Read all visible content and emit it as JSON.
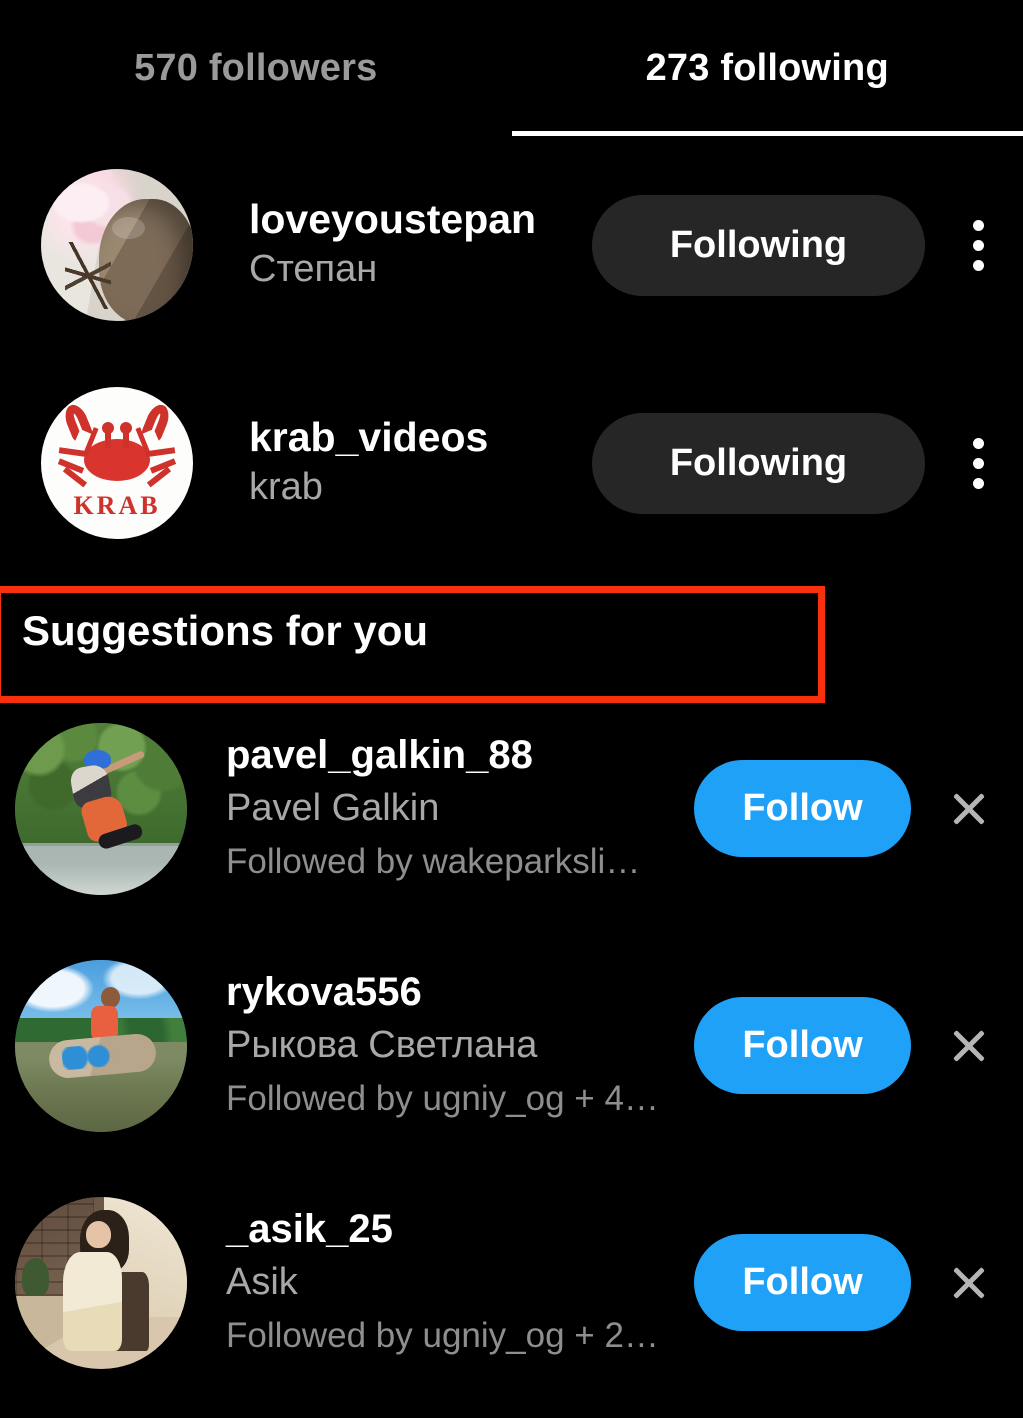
{
  "tabs": [
    {
      "label": "570 followers",
      "name": "tab-followers",
      "active": false
    },
    {
      "label": "273 following",
      "name": "tab-following",
      "active": true
    }
  ],
  "following_list": [
    {
      "username": "loveyoustepan",
      "fullname": "Степан",
      "button_label": "Following",
      "avatar": "cat-with-magnolia-flower",
      "menu_icon": "kebab-menu-icon"
    },
    {
      "username": "krab_videos",
      "fullname": "krab",
      "button_label": "Following",
      "avatar": "red-crab-logo",
      "avatar_text": "KRAB",
      "menu_icon": "kebab-menu-icon"
    }
  ],
  "suggestions_section": {
    "title": "Suggestions for you",
    "items": [
      {
        "username": "pavel_galkin_88",
        "fullname": "Pavel Galkin",
        "context": "Followed by wakeparksli…",
        "button_label": "Follow",
        "avatar": "wakeboarder-blue-helmet",
        "dismiss_icon": "close-icon"
      },
      {
        "username": "rykova556",
        "fullname": "Рыкова Светлана",
        "context": "Followed by ugniy_og + 4…",
        "button_label": "Follow",
        "avatar": "woman-with-wakeboard",
        "dismiss_icon": "close-icon"
      },
      {
        "username": "_asik_25",
        "fullname": "Asik",
        "context": "Followed by ugniy_og + 2…",
        "button_label": "Follow",
        "avatar": "woman-in-cafe",
        "dismiss_icon": "close-icon"
      }
    ]
  },
  "colors": {
    "background": "#000000",
    "follow_button": "#1EA1F7",
    "following_button": "#262626",
    "active_tab_text": "#FFFFFF",
    "inactive_tab_text": "#9A9A9A",
    "secondary_text": "#A8A8A8",
    "annotation_outline": "#F8300E"
  }
}
